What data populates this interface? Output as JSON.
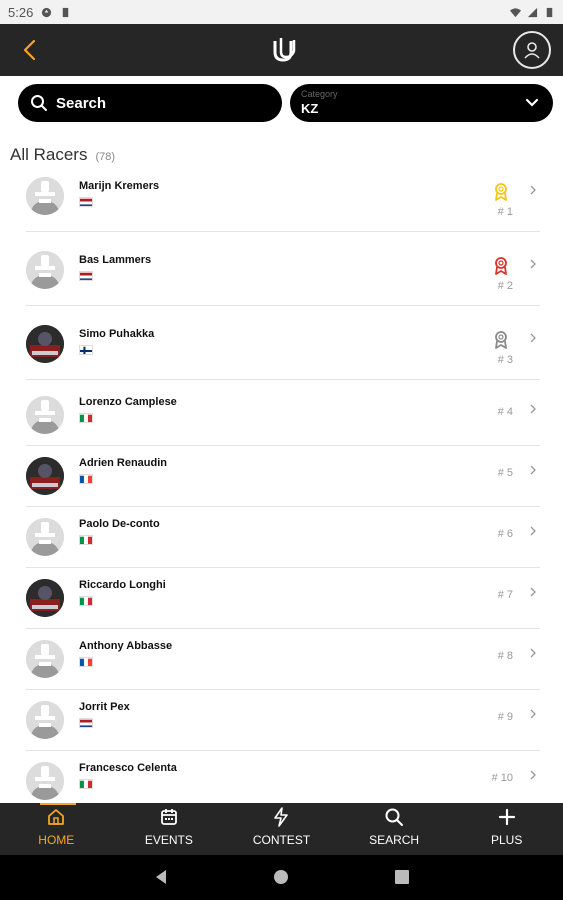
{
  "status_bar": {
    "time": "5:26"
  },
  "header": {
    "logo_text": "U"
  },
  "search": {
    "label": "Search"
  },
  "category": {
    "label": "Category",
    "value": "KZ"
  },
  "section": {
    "title": "All Racers",
    "count": "(78)"
  },
  "racers": [
    {
      "name": "Marijn Kremers",
      "rank": "# 1",
      "flag": "NL",
      "medal": "gold",
      "avatar": "placeholder"
    },
    {
      "name": "Bas Lammers",
      "rank": "# 2",
      "flag": "NL",
      "medal": "red",
      "avatar": "placeholder"
    },
    {
      "name": "Simo Puhakka",
      "rank": "# 3",
      "flag": "FI",
      "medal": "grey",
      "avatar": "photo"
    },
    {
      "name": "Lorenzo Camplese",
      "rank": "# 4",
      "flag": "IT",
      "medal": "",
      "avatar": "placeholder"
    },
    {
      "name": "Adrien Renaudin",
      "rank": "# 5",
      "flag": "FR",
      "medal": "",
      "avatar": "photo"
    },
    {
      "name": "Paolo De-conto",
      "rank": "# 6",
      "flag": "IT",
      "medal": "",
      "avatar": "placeholder"
    },
    {
      "name": "Riccardo Longhi",
      "rank": "# 7",
      "flag": "IT",
      "medal": "",
      "avatar": "photo"
    },
    {
      "name": "Anthony Abbasse",
      "rank": "# 8",
      "flag": "FR",
      "medal": "",
      "avatar": "placeholder"
    },
    {
      "name": "Jorrit Pex",
      "rank": "# 9",
      "flag": "NL",
      "medal": "",
      "avatar": "placeholder"
    },
    {
      "name": "Francesco Celenta",
      "rank": "# 10",
      "flag": "IT",
      "medal": "",
      "avatar": "placeholder"
    }
  ],
  "bottom_nav": [
    {
      "label": "HOME",
      "icon": "home-icon",
      "active": true
    },
    {
      "label": "EVENTS",
      "icon": "calendar-icon",
      "active": false
    },
    {
      "label": "CONTEST",
      "icon": "bolt-icon",
      "active": false
    },
    {
      "label": "SEARCH",
      "icon": "search-icon",
      "active": false
    },
    {
      "label": "PLUS",
      "icon": "plus-icon",
      "active": false
    }
  ],
  "colors": {
    "accent": "#f5a623",
    "gold": "#f5c518",
    "red": "#e0302a",
    "grey": "#8a8a8a",
    "bar": "#262626"
  }
}
